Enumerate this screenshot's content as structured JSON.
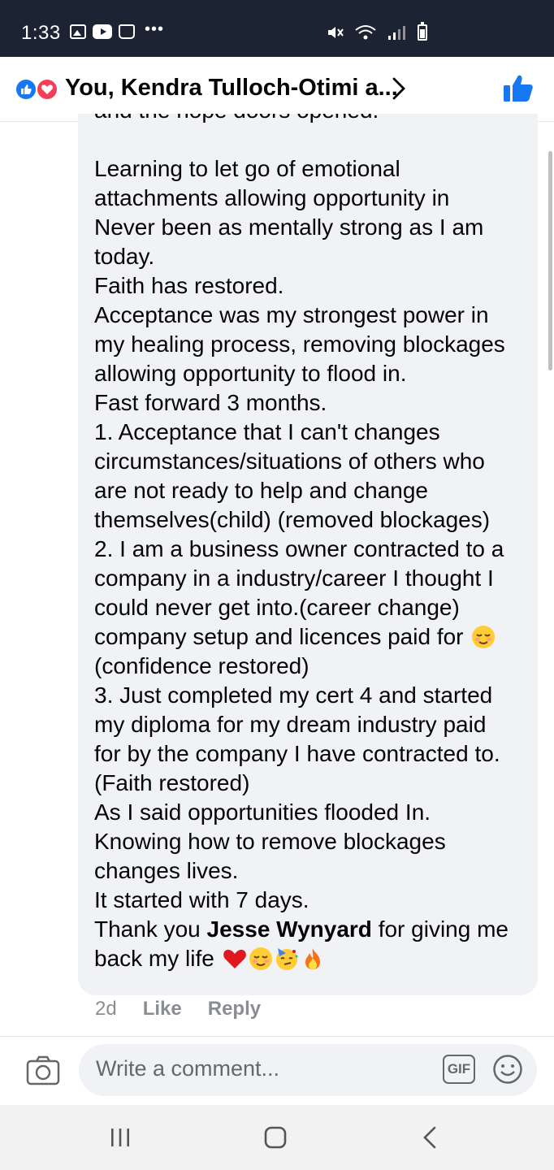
{
  "status_bar": {
    "time": "1:33",
    "dots": "•••"
  },
  "header": {
    "title": "You, Kendra Tulloch-Otimi a...",
    "reactions": [
      "like",
      "love"
    ],
    "accent_color": "#1877f2"
  },
  "comment": {
    "partial_top_line": "and the hope doors opened.",
    "paragraph_lines": [
      "Learning to let  go of emotional",
      "attachments allowing opportunity in",
      "Never been as mentally strong as I am",
      "today.",
      "Faith has restored.",
      "Acceptance was my strongest power in",
      "my healing process, removing blockages",
      "allowing opportunity to flood in.",
      "Fast forward 3 months.",
      "1. Acceptance that I can't changes",
      "circumstances/situations of others who",
      "are not ready to help and change",
      "themselves(child) (removed blockages)",
      "2. I am a business owner contracted to a",
      "company in a industry/career I thought I",
      "could never get into.(career change)"
    ],
    "line_with_emoji": "company setup and licences paid for",
    "paragraph_lines_2": [
      "(confidence restored)",
      "3. Just completed my cert 4 and started",
      "my diploma for my dream industry paid",
      "for by the company I have contracted to.",
      "(Faith restored)",
      "As I said opportunities flooded In.",
      "Knowing how to remove blockages",
      "changes lives.",
      "It started with 7 days."
    ],
    "thanks_prefix": "Thank you ",
    "thanks_name": "Jesse Wynyard",
    "thanks_suffix": " for giving me",
    "last_line": "back my life",
    "last_line_emojis": [
      "red-heart",
      "relieved-face",
      "partying-face",
      "fire"
    ]
  },
  "meta": {
    "age": "2d",
    "like_label": "Like",
    "reply_label": "Reply"
  },
  "composer": {
    "placeholder": "Write a comment...",
    "gif_label": "GIF"
  },
  "nav_bar": {
    "icons": [
      "recent-apps-icon",
      "home-icon",
      "back-icon"
    ]
  }
}
